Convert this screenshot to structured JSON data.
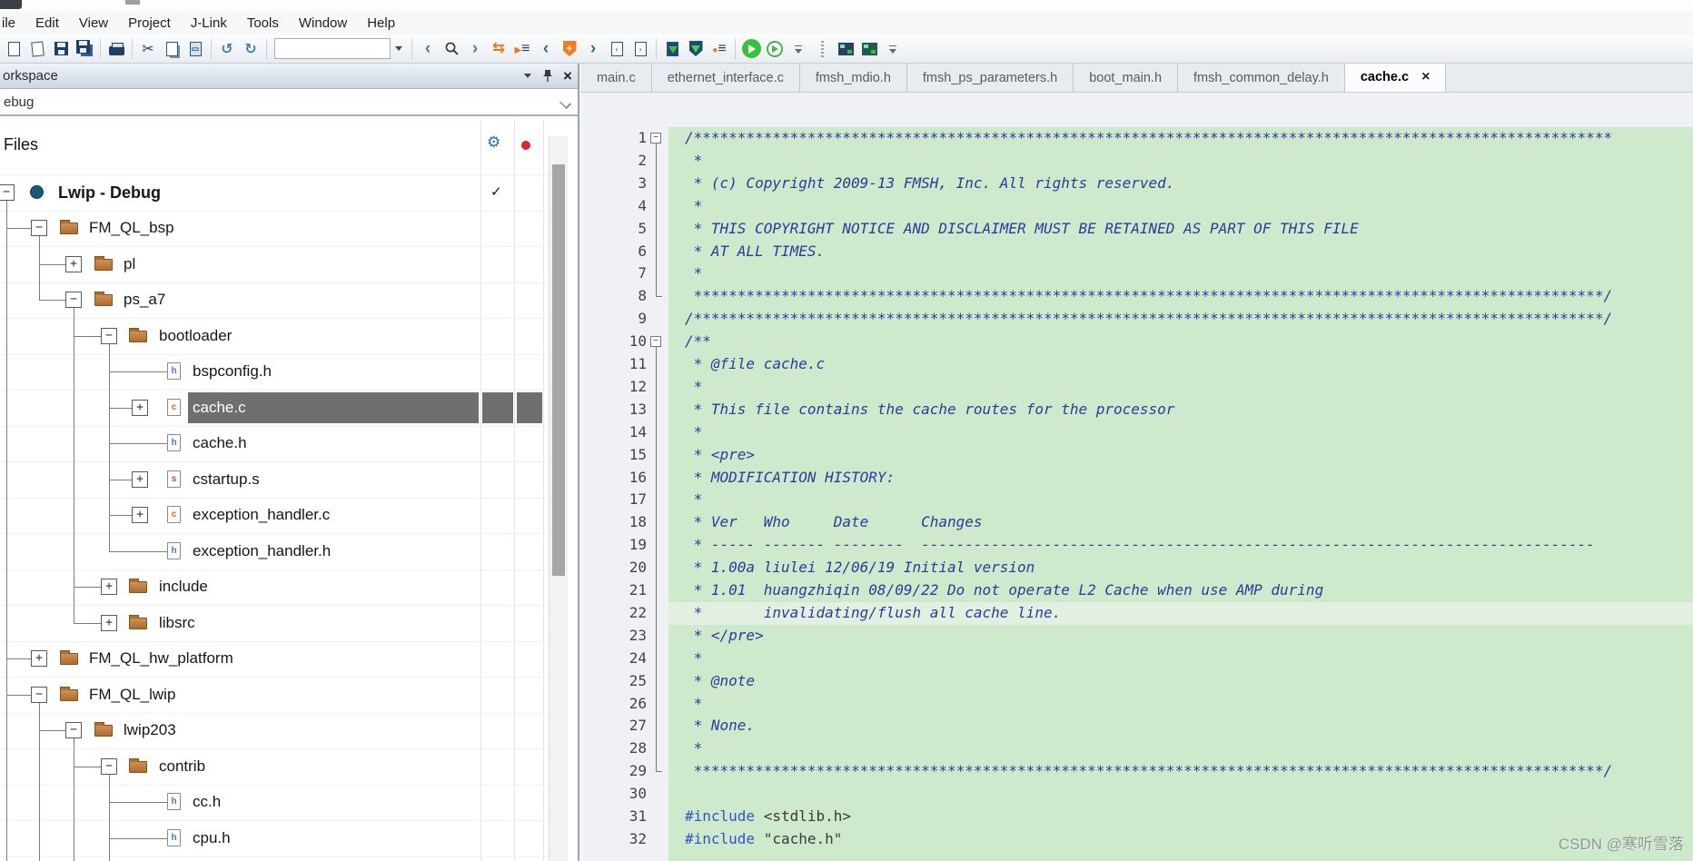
{
  "menubar": {
    "items": [
      "ile",
      "Edit",
      "View",
      "Project",
      "J-Link",
      "Tools",
      "Window",
      "Help"
    ]
  },
  "toolbar": {
    "search_value": "",
    "items": [
      {
        "type": "icon",
        "name": "new-file-icon"
      },
      {
        "type": "icon",
        "name": "open-file-icon"
      },
      {
        "type": "icon",
        "name": "save-icon"
      },
      {
        "type": "icon",
        "name": "save-all-icon"
      },
      {
        "type": "sep"
      },
      {
        "type": "icon",
        "name": "print-icon"
      },
      {
        "type": "sep"
      },
      {
        "type": "icon",
        "name": "cut-icon"
      },
      {
        "type": "icon",
        "name": "copy-icon"
      },
      {
        "type": "icon",
        "name": "paste-icon"
      },
      {
        "type": "sep"
      },
      {
        "type": "icon",
        "name": "undo-icon"
      },
      {
        "type": "icon",
        "name": "redo-icon"
      },
      {
        "type": "sep"
      },
      {
        "type": "combo"
      },
      {
        "type": "combo-btn"
      },
      {
        "type": "sep"
      },
      {
        "type": "icon",
        "name": "search-back-icon"
      },
      {
        "type": "icon",
        "name": "search-icon"
      },
      {
        "type": "icon",
        "name": "search-forward-icon"
      },
      {
        "type": "icon",
        "name": "swap-arrows-icon"
      },
      {
        "type": "icon",
        "name": "bookmark-list-icon"
      },
      {
        "type": "icon",
        "name": "prev-bookmark-icon"
      },
      {
        "type": "icon",
        "name": "toggle-bookmark-icon"
      },
      {
        "type": "icon",
        "name": "next-bookmark-icon"
      },
      {
        "type": "icon",
        "name": "prev-doc-icon"
      },
      {
        "type": "icon",
        "name": "next-doc-icon"
      },
      {
        "type": "sep"
      },
      {
        "type": "icon",
        "name": "download-file-icon"
      },
      {
        "type": "icon",
        "name": "download-flash-icon"
      },
      {
        "type": "icon",
        "name": "make-list-icon"
      },
      {
        "type": "sep"
      },
      {
        "type": "icon",
        "name": "download-and-debug-icon"
      },
      {
        "type": "icon",
        "name": "debug-without-download-icon"
      },
      {
        "type": "icon",
        "name": "toolbar-overflow-icon"
      },
      {
        "type": "icon",
        "name": "drag-handle-icon"
      },
      {
        "type": "icon",
        "name": "board-make-icon"
      },
      {
        "type": "icon",
        "name": "board-rebuild-icon"
      },
      {
        "type": "icon",
        "name": "toolbar-overflow2-icon"
      }
    ]
  },
  "workspace": {
    "title": "orkspace",
    "config_selected": "ebug",
    "files_header": "Files",
    "controls": {
      "dropdown": "dropdown-icon",
      "pin": "pin-icon",
      "close": "×"
    },
    "tree": [
      {
        "label": "Lwip - Debug",
        "level": 0,
        "expander": "-",
        "icon": "project",
        "bold": true,
        "check": "✓"
      },
      {
        "label": "FM_QL_bsp",
        "level": 1,
        "expander": "-",
        "icon": "folder"
      },
      {
        "label": "pl",
        "level": 2,
        "expander": "+",
        "icon": "folder"
      },
      {
        "label": "ps_a7",
        "level": 2,
        "expander": "-",
        "icon": "folder"
      },
      {
        "label": "bootloader",
        "level": 3,
        "expander": "-",
        "icon": "folder"
      },
      {
        "label": "bspconfig.h",
        "level": 4,
        "expander": null,
        "icon": "file-h"
      },
      {
        "label": "cache.c",
        "level": 4,
        "expander": "+",
        "icon": "file-c",
        "selected": true
      },
      {
        "label": "cache.h",
        "level": 4,
        "expander": null,
        "icon": "file-h"
      },
      {
        "label": "cstartup.s",
        "level": 4,
        "expander": "+",
        "icon": "file-s"
      },
      {
        "label": "exception_handler.c",
        "level": 4,
        "expander": "+",
        "icon": "file-c"
      },
      {
        "label": "exception_handler.h",
        "level": 4,
        "expander": null,
        "icon": "file-h"
      },
      {
        "label": "include",
        "level": 3,
        "expander": "+",
        "icon": "folder"
      },
      {
        "label": "libsrc",
        "level": 3,
        "expander": "+",
        "icon": "folder"
      },
      {
        "label": "FM_QL_hw_platform",
        "level": 1,
        "expander": "+",
        "icon": "folder"
      },
      {
        "label": "FM_QL_lwip",
        "level": 1,
        "expander": "-",
        "icon": "folder"
      },
      {
        "label": "lwip203",
        "level": 2,
        "expander": "-",
        "icon": "folder"
      },
      {
        "label": "contrib",
        "level": 3,
        "expander": "-",
        "icon": "folder"
      },
      {
        "label": "cc.h",
        "level": 4,
        "expander": null,
        "icon": "file-h"
      },
      {
        "label": "cpu.h",
        "level": 4,
        "expander": null,
        "icon": "file-h"
      }
    ]
  },
  "editor": {
    "tabs": [
      {
        "label": "main.c",
        "active": false
      },
      {
        "label": "ethernet_interface.c",
        "active": false
      },
      {
        "label": "fmsh_mdio.h",
        "active": false
      },
      {
        "label": "fmsh_ps_parameters.h",
        "active": false
      },
      {
        "label": "boot_main.h",
        "active": false
      },
      {
        "label": "fmsh_common_delay.h",
        "active": false
      },
      {
        "label": "cache.c",
        "active": true,
        "close": "×"
      }
    ],
    "folds": [
      {
        "start": 1,
        "end": 8
      },
      {
        "start": 10,
        "end": 29
      }
    ],
    "current_line": 22,
    "code": [
      {
        "n": 1,
        "fold": "start",
        "tokens": [
          {
            "c": "cmt",
            "t": "/*********************************************************************************************************"
          }
        ]
      },
      {
        "n": 2,
        "tokens": [
          {
            "c": "cmt",
            "t": " *"
          }
        ]
      },
      {
        "n": 3,
        "tokens": [
          {
            "c": "cmt",
            "t": " * (c) Copyright 2009-13 FMSH, Inc. All rights reserved."
          }
        ]
      },
      {
        "n": 4,
        "tokens": [
          {
            "c": "cmt",
            "t": " *"
          }
        ]
      },
      {
        "n": 5,
        "tokens": [
          {
            "c": "cmt",
            "t": " * THIS COPYRIGHT NOTICE AND DISCLAIMER MUST BE RETAINED AS PART OF THIS FILE"
          }
        ]
      },
      {
        "n": 6,
        "tokens": [
          {
            "c": "cmt",
            "t": " * AT ALL TIMES."
          }
        ]
      },
      {
        "n": 7,
        "tokens": [
          {
            "c": "cmt",
            "t": " *"
          }
        ]
      },
      {
        "n": 8,
        "fold": "end",
        "tokens": [
          {
            "c": "cmt",
            "t": " ********************************************************************************************************/"
          }
        ]
      },
      {
        "n": 9,
        "tokens": [
          {
            "c": "cmt",
            "t": "/********************************************************************************************************/"
          }
        ]
      },
      {
        "n": 10,
        "fold": "start",
        "tokens": [
          {
            "c": "cmt",
            "t": "/**"
          }
        ]
      },
      {
        "n": 11,
        "tokens": [
          {
            "c": "cmt",
            "t": " * @file cache.c"
          }
        ]
      },
      {
        "n": 12,
        "tokens": [
          {
            "c": "cmt",
            "t": " *"
          }
        ]
      },
      {
        "n": 13,
        "tokens": [
          {
            "c": "cmt",
            "t": " * This file contains the cache routes for the processor"
          }
        ]
      },
      {
        "n": 14,
        "tokens": [
          {
            "c": "cmt",
            "t": " *"
          }
        ]
      },
      {
        "n": 15,
        "tokens": [
          {
            "c": "cmt",
            "t": " * <pre>"
          }
        ]
      },
      {
        "n": 16,
        "tokens": [
          {
            "c": "cmt",
            "t": " * MODIFICATION HISTORY:"
          }
        ]
      },
      {
        "n": 17,
        "tokens": [
          {
            "c": "cmt",
            "t": " *"
          }
        ]
      },
      {
        "n": 18,
        "tokens": [
          {
            "c": "cmt",
            "t": " * Ver   Who     Date      Changes"
          }
        ]
      },
      {
        "n": 19,
        "tokens": [
          {
            "c": "cmt",
            "t": " * ----- ------- --------  -----------------------------------------------------------------------------"
          }
        ]
      },
      {
        "n": 20,
        "tokens": [
          {
            "c": "cmt",
            "t": " * 1.00a liulei 12/06/19 Initial version"
          }
        ]
      },
      {
        "n": 21,
        "tokens": [
          {
            "c": "cmt",
            "t": " * 1.01  huangzhiqin 08/09/22 Do not operate L2 Cache when use AMP during"
          }
        ]
      },
      {
        "n": 22,
        "tokens": [
          {
            "c": "cmt",
            "t": " *       invalidating/flush all cache line."
          }
        ]
      },
      {
        "n": 23,
        "tokens": [
          {
            "c": "cmt",
            "t": " * </pre>"
          }
        ]
      },
      {
        "n": 24,
        "tokens": [
          {
            "c": "cmt",
            "t": " *"
          }
        ]
      },
      {
        "n": 25,
        "tokens": [
          {
            "c": "cmt",
            "t": " * @note"
          }
        ]
      },
      {
        "n": 26,
        "tokens": [
          {
            "c": "cmt",
            "t": " *"
          }
        ]
      },
      {
        "n": 27,
        "tokens": [
          {
            "c": "cmt",
            "t": " * None."
          }
        ]
      },
      {
        "n": 28,
        "tokens": [
          {
            "c": "cmt",
            "t": " *"
          }
        ]
      },
      {
        "n": 29,
        "fold": "end",
        "tokens": [
          {
            "c": "cmt",
            "t": " ********************************************************************************************************/"
          }
        ]
      },
      {
        "n": 30,
        "tokens": []
      },
      {
        "n": 31,
        "tokens": [
          {
            "c": "pp",
            "t": "#include"
          },
          {
            "c": "inc",
            "t": " <stdlib.h>"
          }
        ]
      },
      {
        "n": 32,
        "tokens": [
          {
            "c": "pp",
            "t": "#include"
          },
          {
            "c": "inc",
            "t": " \"cache.h\""
          }
        ]
      }
    ]
  },
  "watermark": {
    "text": "CSDN @寒听雪落"
  },
  "colors": {
    "editor_bg": "#cfe9cd",
    "comment": "#2a3c9a",
    "preprocessor": "#2f55c8",
    "selection_bg": "#6f6f6f",
    "folder": "#bf7d3f",
    "accent_orange": "#e87a1e",
    "run_green": "#38c03a"
  }
}
